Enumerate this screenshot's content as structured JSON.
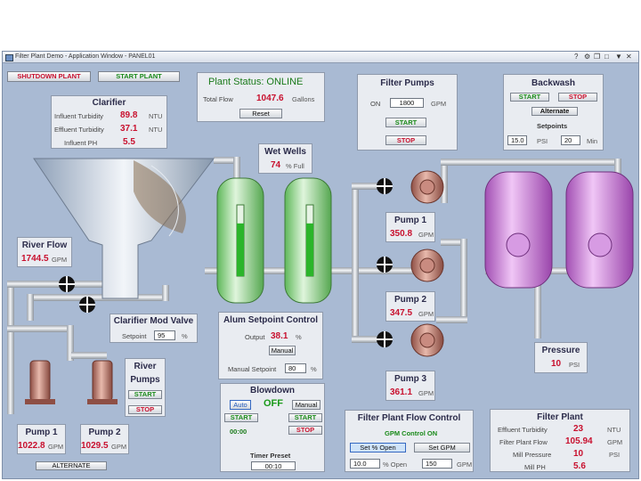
{
  "window": {
    "title": "Filter Plant Demo - Application Window - PANEL01"
  },
  "toolbar": {
    "shutdown_label": "SHUTDOWN PLANT",
    "start_label": "START PLANT"
  },
  "status": {
    "title": "Plant Status: ONLINE",
    "total_flow_label": "Total Flow",
    "total_flow_value": "1047.6",
    "total_flow_unit": "Gallons",
    "reset_label": "Reset"
  },
  "clarifier": {
    "title": "Clarifier",
    "rows": [
      {
        "label": "Influent Turbidity",
        "value": "89.8",
        "unit": "NTU"
      },
      {
        "label": "Effluent Turbidity",
        "value": "37.1",
        "unit": "NTU"
      },
      {
        "label": "Influent PH",
        "value": "5.5",
        "unit": ""
      }
    ]
  },
  "filter_pumps": {
    "title": "Filter Pumps",
    "on_label": "ON",
    "setpoint": "1800",
    "unit": "GPM",
    "start_label": "START",
    "stop_label": "STOP"
  },
  "backwash": {
    "title": "Backwash",
    "start_label": "START",
    "stop_label": "STOP",
    "alternate_label": "Alternate",
    "setpoints_label": "Setpoints",
    "psi_value": "15.0",
    "psi_unit": "PSI",
    "min_value": "20",
    "min_unit": "Min"
  },
  "wet_wells": {
    "title": "Wet Wells",
    "value": "74",
    "unit": "% Full",
    "level_fraction": 0.74
  },
  "river_flow": {
    "title": "River Flow",
    "value": "1744.5",
    "unit": "GPM"
  },
  "clarifier_valve": {
    "title": "Clarifier Mod Valve",
    "setpoint_label": "Setpoint",
    "setpoint_value": "95",
    "unit": "%"
  },
  "alum": {
    "title": "Alum Setpoint Control",
    "output_label": "Output",
    "output_value": "38.1",
    "output_unit": "%",
    "manual_label": "Manual",
    "manual_setpoint_label": "Manual Setpoint",
    "manual_setpoint_value": "80",
    "manual_unit": "%"
  },
  "river_pumps": {
    "title_line1": "River",
    "title_line2": "Pumps",
    "start_label": "START",
    "stop_label": "STOP"
  },
  "river_pump1": {
    "title": "Pump 1",
    "value": "1022.8",
    "unit": "GPM"
  },
  "river_pump2": {
    "title": "Pump 2",
    "value": "1029.5",
    "unit": "GPM"
  },
  "alternate_label": "ALTERNATE",
  "blowdown": {
    "title": "Blowdown",
    "auto_label": "Auto",
    "state": "OFF",
    "manual_label": "Manual",
    "start_left": "START",
    "start_right": "START",
    "time": "00:00",
    "stop_label": "STOP",
    "timer_label": "Timer Preset",
    "timer_value": "00:10"
  },
  "filter_pump1": {
    "title": "Pump 1",
    "value": "350.8",
    "unit": "GPM"
  },
  "filter_pump2": {
    "title": "Pump 2",
    "value": "347.5",
    "unit": "GPM"
  },
  "filter_pump3": {
    "title": "Pump 3",
    "value": "361.1",
    "unit": "GPM"
  },
  "pressure": {
    "title": "Pressure",
    "value": "10",
    "unit": "PSI"
  },
  "flow_control": {
    "title": "Filter Plant Flow Control",
    "status": "GPM Control ON",
    "set_open_label": "Set % Open",
    "set_gpm_label": "Set GPM",
    "open_value": "10.0",
    "open_unit": "% Open",
    "gpm_value": "150",
    "gpm_unit": "GPM"
  },
  "filter_plant": {
    "title": "Filter Plant",
    "rows": [
      {
        "label": "Effluent Turbidity",
        "value": "23",
        "unit": "NTU"
      },
      {
        "label": "Filter Plant Flow",
        "value": "105.94",
        "unit": "GPM"
      },
      {
        "label": "Mill Pressure",
        "value": "10",
        "unit": "PSI"
      },
      {
        "label": "Mill PH",
        "value": "5.6",
        "unit": ""
      }
    ]
  },
  "colors": {
    "pipe": "#d3d7dc",
    "tank_green": "#7fd37a",
    "tank_purple": "#c879d6",
    "pump_copper": "#b3746a",
    "alarm_red": "#c8102e"
  }
}
